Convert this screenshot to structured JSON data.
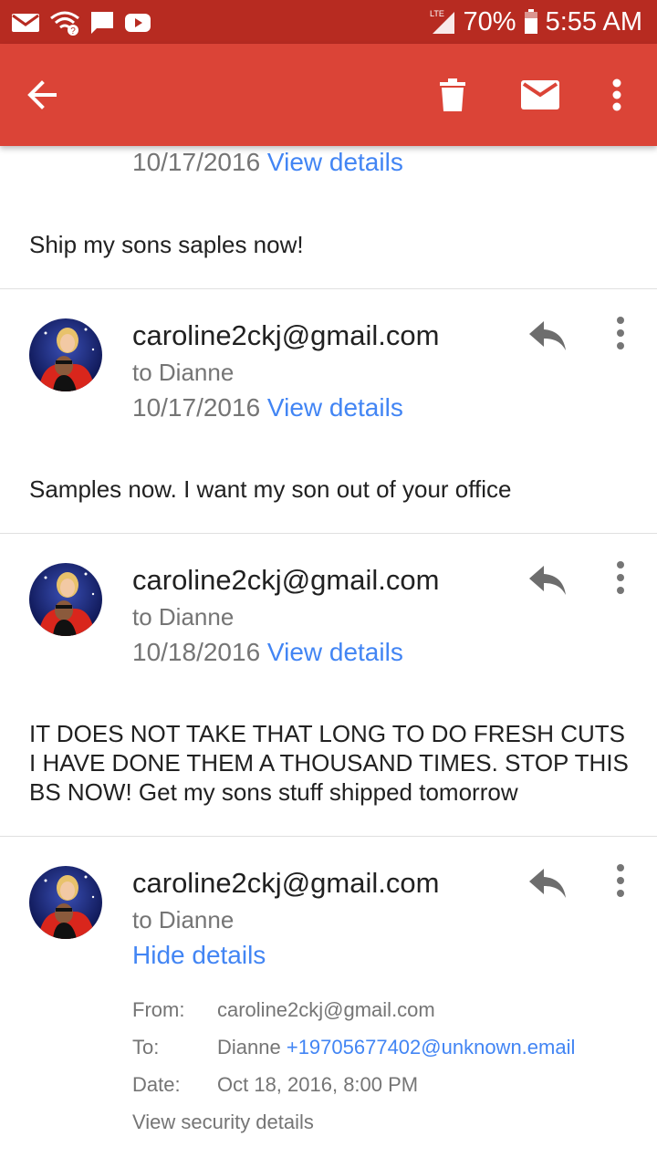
{
  "status": {
    "time": "5:55 AM",
    "battery": "70%",
    "network": "LTE",
    "icons": [
      "gmail-icon",
      "wifi-icon",
      "chat-icon",
      "youtube-icon"
    ]
  },
  "appbar": {
    "color": "#db4437",
    "icons": [
      "back-arrow-icon",
      "trash-icon",
      "mail-icon",
      "more-vert-icon"
    ]
  },
  "messages": [
    {
      "date": "10/17/2016",
      "view_details": "View details",
      "body": "Ship my sons saples now!"
    },
    {
      "sender": "caroline2ckj@gmail.com",
      "to": "to Dianne",
      "date": "10/17/2016",
      "view_details": "View details",
      "body": "Samples now.  I want my son out of your office"
    },
    {
      "sender": "caroline2ckj@gmail.com",
      "to": "to Dianne",
      "date": "10/18/2016",
      "view_details": "View details",
      "body": "IT DOES NOT TAKE THAT LONG TO DO FRESH CUTS I HAVE DONE THEM A THOUSAND TIMES. STOP THIS BS NOW! Get my sons stuff shipped tomorrow"
    },
    {
      "sender": "caroline2ckj@gmail.com",
      "to": "to Dianne",
      "hide_details": "Hide details",
      "details": {
        "from_label": "From:",
        "from_value": "caroline2ckj@gmail.com",
        "to_label": "To:",
        "to_name": "Dianne",
        "to_value": "+19705677402@unknown.email",
        "date_label": "Date:",
        "date_value": "Oct 18, 2016, 8:00 PM",
        "security": "View security details"
      }
    }
  ]
}
